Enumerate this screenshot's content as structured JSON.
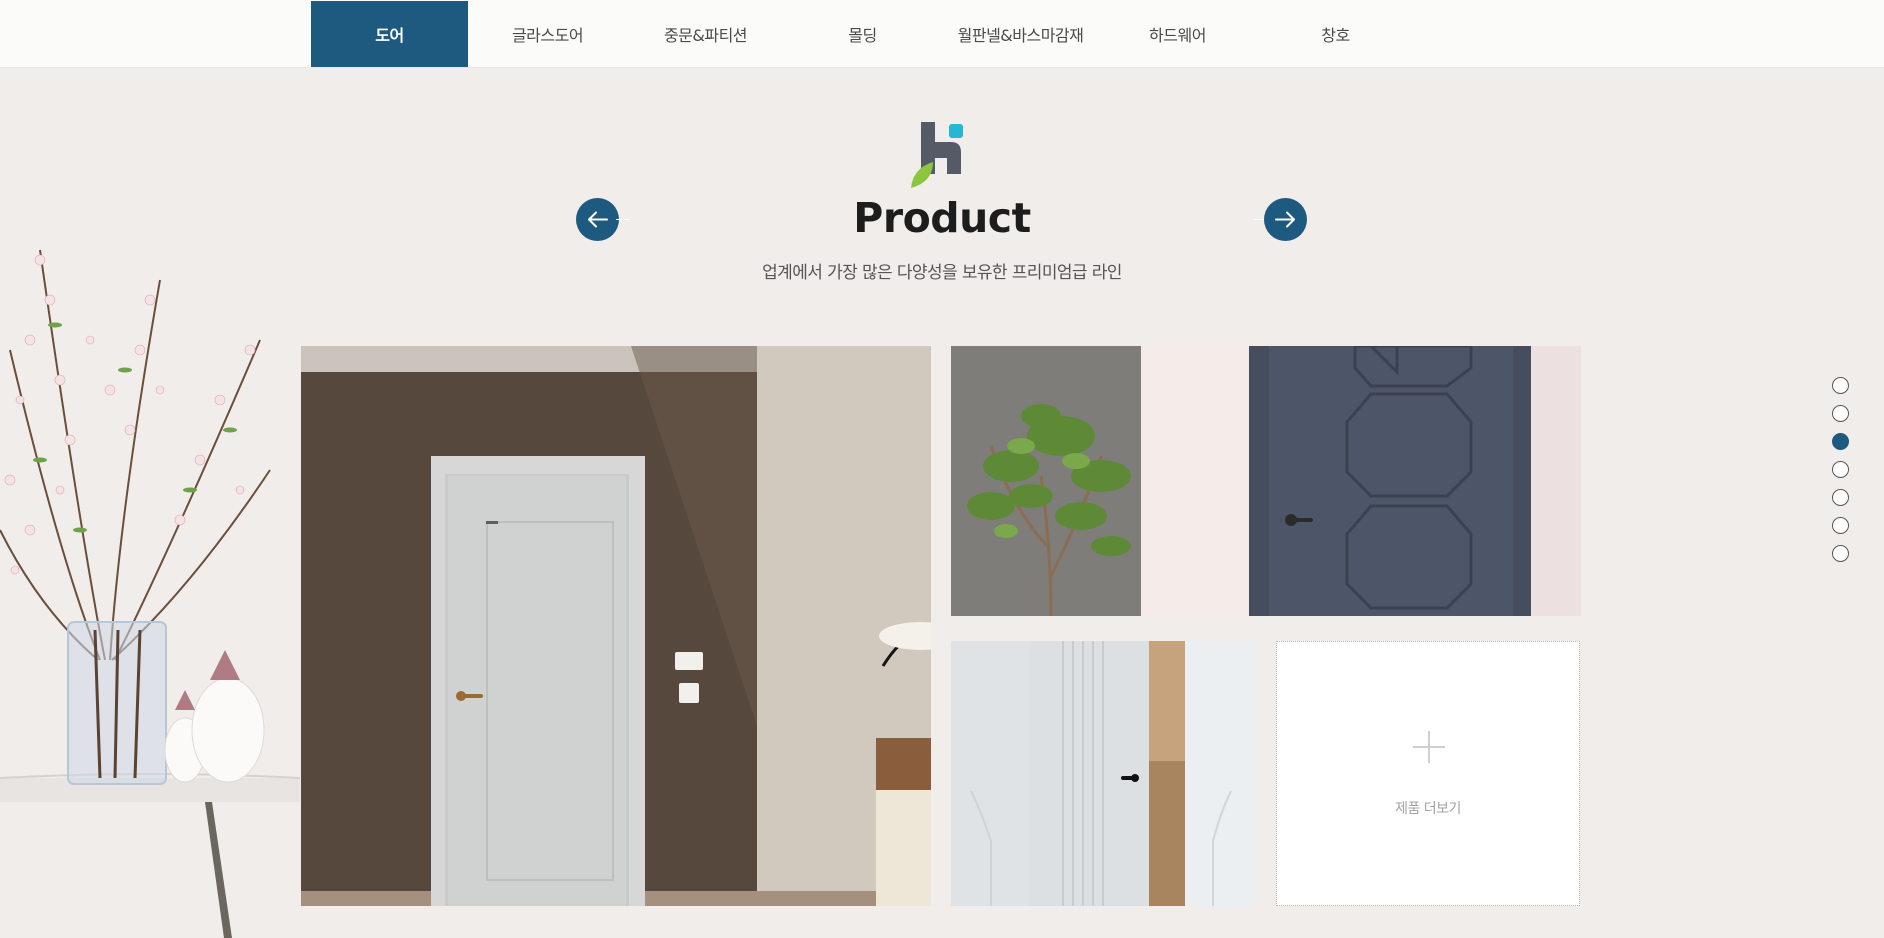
{
  "nav": {
    "tabs": [
      {
        "label": "도어",
        "active": true
      },
      {
        "label": "글라스도어",
        "active": false
      },
      {
        "label": "중문&파티션",
        "active": false
      },
      {
        "label": "몰딩",
        "active": false
      },
      {
        "label": "월판넬&바스마감재",
        "active": false
      },
      {
        "label": "하드웨어",
        "active": false
      },
      {
        "label": "창호",
        "active": false
      }
    ]
  },
  "section": {
    "title": "Product",
    "subtitle": "업계에서 가장 많은 다양성을 보유한 프리미엄급 라인",
    "more_label": "제품 더보기"
  },
  "pager": {
    "total": 7,
    "active_index": 2
  },
  "colors": {
    "accent": "#1e5a80",
    "background": "#f1edea",
    "logo_dark": "#545b66",
    "logo_cyan": "#26b7d4",
    "logo_green": "#8cc63f"
  },
  "icons": {
    "prev": "arrow-left-icon",
    "next": "arrow-right-icon",
    "more": "plus-icon"
  }
}
